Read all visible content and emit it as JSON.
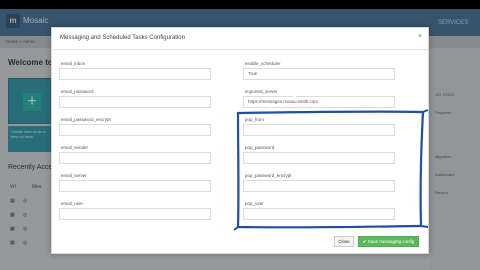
{
  "app": {
    "logo_text": "Mosaic",
    "topright_text": "SERVICES",
    "breadcrumb": "Home > Admin",
    "welcome": "Welcome to m",
    "tile_text": "Create new vrl as a new vrl form",
    "recent_title": "Recently Acce",
    "table_headers": [
      "Vrl",
      "Mes"
    ],
    "right_panel": [
      "GO TODO",
      "Progress",
      "Migration",
      "Dashboard",
      "Recent"
    ]
  },
  "modal": {
    "title": "Messaging and Scheduled Tasks Configuration",
    "close_glyph": "×",
    "fields": [
      {
        "label": "email_inbox",
        "value": ""
      },
      {
        "label": "enable_scheduler",
        "value": "True"
      },
      {
        "label": "email_password",
        "value": ""
      },
      {
        "label": "imported_server",
        "value": "https://messages.mosaicsmith.com"
      },
      {
        "label": "email_password_encrypt",
        "value": ""
      },
      {
        "label": "pop_from",
        "value": ""
      },
      {
        "label": "email_sender",
        "value": ""
      },
      {
        "label": "pop_password",
        "value": ""
      },
      {
        "label": "email_server",
        "value": ""
      },
      {
        "label": "pop_password_encrypt",
        "value": ""
      },
      {
        "label": "email_user",
        "value": ""
      },
      {
        "label": "pop_user",
        "value": ""
      }
    ],
    "close_button": "Close",
    "save_button": "✔ Save messaging config"
  },
  "colors": {
    "annotation": "#1e4fa3",
    "save_button": "#5cb85c",
    "topbar": "#3c6a91"
  }
}
